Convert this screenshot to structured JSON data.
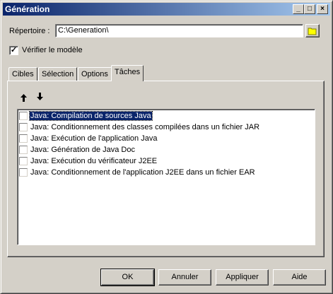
{
  "window": {
    "title": "Génération",
    "controls": [
      "minimize",
      "maximize",
      "close"
    ]
  },
  "directory": {
    "label": "Répertoire :",
    "value": "C:\\Generation\\"
  },
  "verify_model": {
    "label": "Vérifier le modèle",
    "checked": true
  },
  "tabs": [
    {
      "label": "Cibles",
      "active": false
    },
    {
      "label": "Sélection",
      "active": false
    },
    {
      "label": "Options",
      "active": false
    },
    {
      "label": "Tâches",
      "active": true
    }
  ],
  "move": {
    "up_icon": "arrow-up-icon",
    "down_icon": "arrow-down-icon"
  },
  "tasks": [
    {
      "label": "Java: Compilation de sources Java",
      "checked": false,
      "selected": true
    },
    {
      "label": "Java: Conditionnement des classes compilées dans un fichier JAR",
      "checked": false,
      "selected": false
    },
    {
      "label": "Java: Exécution de l'application Java",
      "checked": false,
      "selected": false
    },
    {
      "label": "Java: Génération de Java Doc",
      "checked": false,
      "selected": false
    },
    {
      "label": "Java: Exécution du vérificateur J2EE",
      "checked": false,
      "selected": false
    },
    {
      "label": "Java: Conditionnement de l'application J2EE dans un fichier EAR",
      "checked": false,
      "selected": false
    }
  ],
  "buttons": {
    "ok": "OK",
    "cancel": "Annuler",
    "apply": "Appliquer",
    "help": "Aide"
  },
  "colors": {
    "title_start": "#0a246a",
    "title_end": "#a6caf0",
    "face": "#d4d0c8",
    "selection": "#0a246a"
  }
}
